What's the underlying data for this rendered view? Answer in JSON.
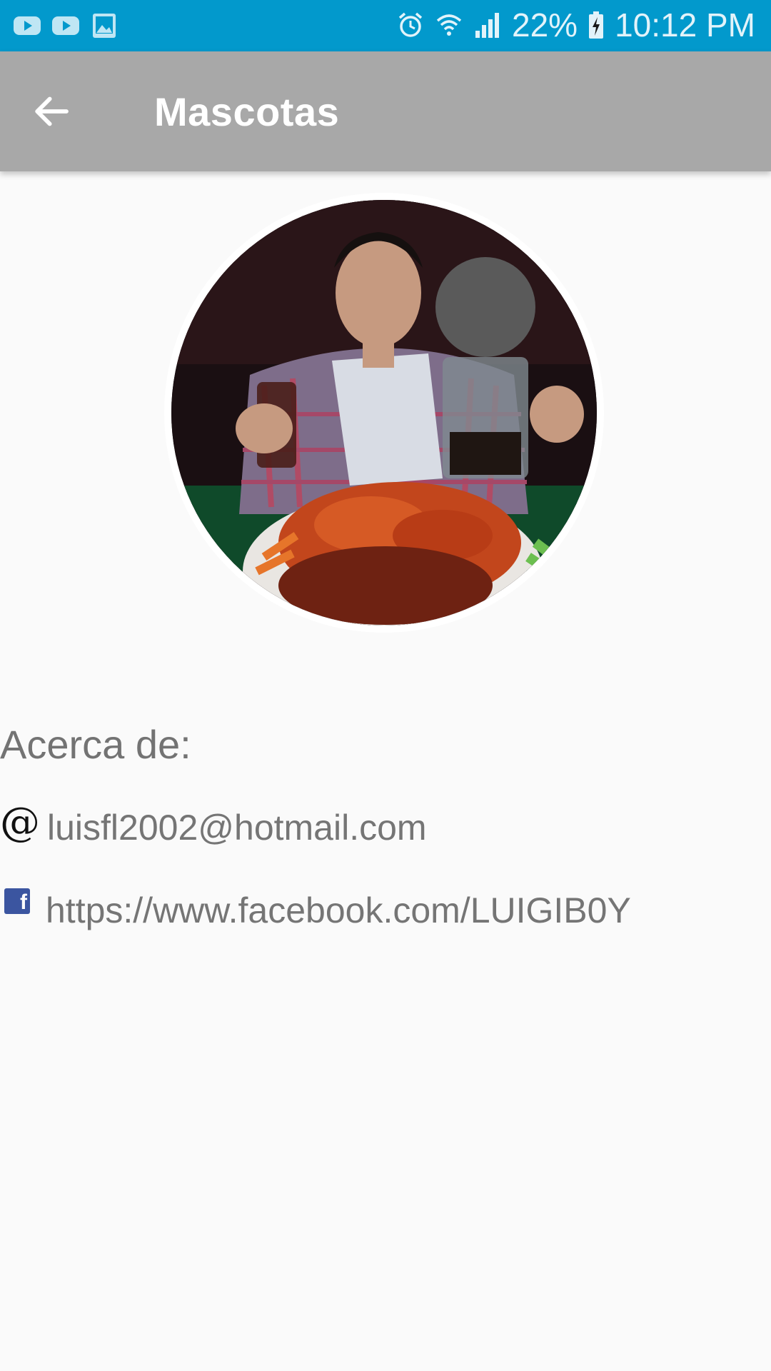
{
  "status_bar": {
    "left_icons": [
      "youtube-icon",
      "youtube-icon",
      "image-icon"
    ],
    "right_icons": [
      "alarm-icon",
      "wifi-icon",
      "signal-icon",
      "battery-charging-icon"
    ],
    "battery": "22%",
    "time": "10:12 PM",
    "color": "#0299cc"
  },
  "app_bar": {
    "title": "Mascotas",
    "back_icon": "arrow-back-icon",
    "color": "#a8a8a8"
  },
  "profile": {
    "avatar_icon": "profile-photo"
  },
  "about": {
    "label": "Acerca de:",
    "email_icon": "@",
    "email": "luisfl2002@hotmail.com",
    "facebook_icon": "f",
    "facebook": "https://www.facebook.com/LUIGIB0Y"
  }
}
